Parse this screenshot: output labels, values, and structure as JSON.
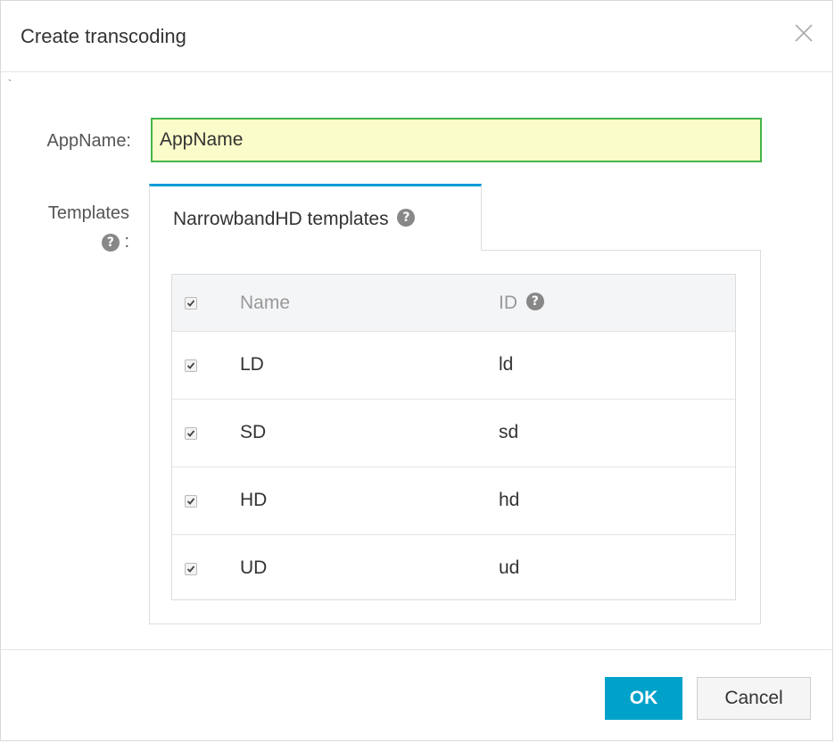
{
  "dialog": {
    "title": "Create transcoding",
    "tick": "`"
  },
  "form": {
    "appname_label": "AppName:",
    "appname_value": "AppName",
    "templates_label": "Templates",
    "templates_suffix": ":"
  },
  "tab": {
    "label": "NarrowbandHD templates"
  },
  "table": {
    "columns": {
      "name": "Name",
      "id": "ID"
    },
    "rows": [
      {
        "name": "LD",
        "id": "ld",
        "checked": true
      },
      {
        "name": "SD",
        "id": "sd",
        "checked": true
      },
      {
        "name": "HD",
        "id": "hd",
        "checked": true
      },
      {
        "name": "UD",
        "id": "ud",
        "checked": true
      }
    ]
  },
  "footer": {
    "ok_label": "OK",
    "cancel_label": "Cancel"
  },
  "icons": {
    "help": "question-circle-icon",
    "close": "close-icon",
    "check": "checkbox-checked-icon"
  },
  "colors": {
    "accent": "#00a2ca",
    "tab_border": "#0e9bd7",
    "input_border": "#44b549",
    "input_bg": "#fafdc9"
  }
}
